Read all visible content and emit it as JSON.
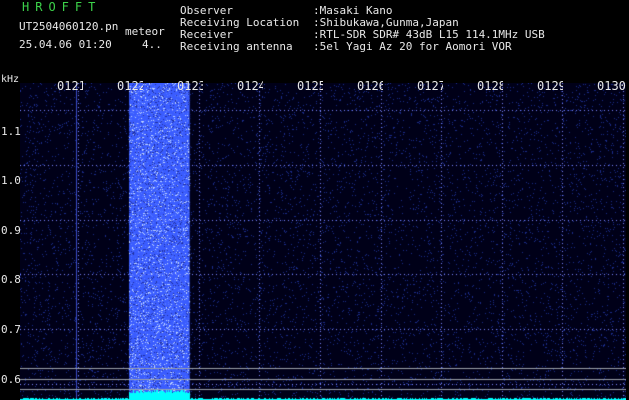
{
  "header": {
    "app_name": "HROFFT",
    "file_name": "UT2504060120.pn",
    "file_tag": "meteor",
    "datetime": "25.04.06 01:20",
    "aux_value": "4.."
  },
  "station_info": [
    {
      "label": "Observer",
      "value": ":Masaki Kano"
    },
    {
      "label": "Receiving Location",
      "value": ":Shibukawa,Gunma,Japan"
    },
    {
      "label": "Receiver",
      "value": ":RTL-SDR SDR# 43dB L15 114.1MHz USB"
    },
    {
      "label": "Receiving antenna",
      "value": ":5el Yagi Az 20 for Aomori VOR"
    }
  ],
  "spectrogram": {
    "unit_label": "kHz",
    "time_ticks": [
      "0121",
      "0122",
      "0123",
      "0124",
      "0125",
      "0126",
      "0127",
      "0128",
      "0129",
      "0130"
    ],
    "freq_ticks": [
      {
        "label": "1.1",
        "value": 1.1
      },
      {
        "label": "1.0",
        "value": 1.0
      },
      {
        "label": "0.9",
        "value": 0.9
      },
      {
        "label": "0.8",
        "value": 0.8
      },
      {
        "label": "0.7",
        "value": 0.7
      },
      {
        "label": "0.6",
        "value": 0.6
      }
    ],
    "freq_range_khz": [
      0.57,
      1.15
    ],
    "time_range_min": [
      0,
      10
    ],
    "bright_band_time_min": [
      1.8,
      2.8
    ],
    "colors": {
      "background": "#000018",
      "noise": "#1a2c8c",
      "band": "#3a5cff",
      "band_bright": "#c8dcff",
      "grid_dots": "#7a86ff",
      "baseline": "#00ffff",
      "hline": "#9aa0a8"
    }
  }
}
